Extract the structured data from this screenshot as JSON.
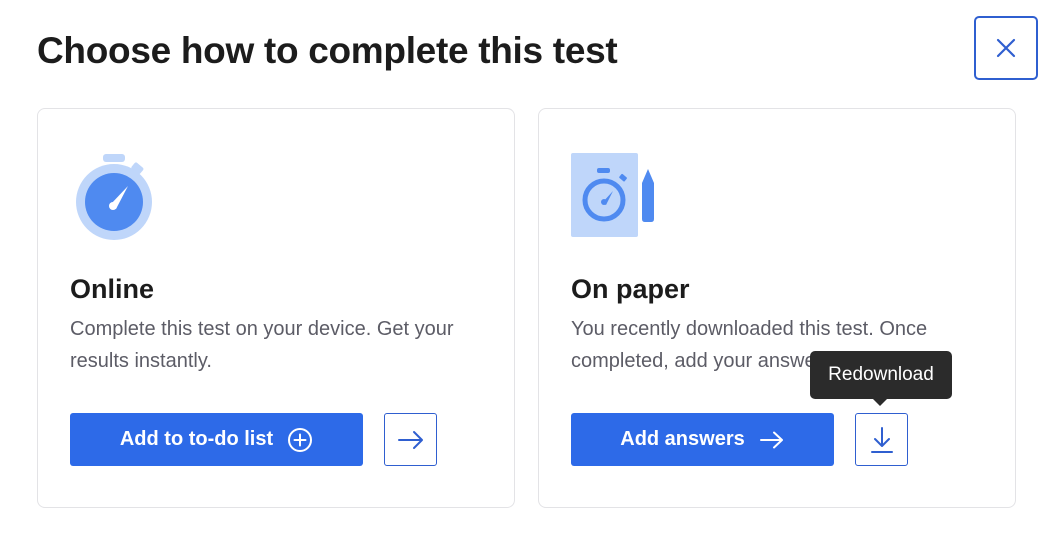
{
  "dialog": {
    "title": "Choose how to complete this test",
    "close_icon": "close-icon"
  },
  "options": [
    {
      "title": "Online",
      "description": "Complete this test on your device. Get your results instantly.",
      "icon": "stopwatch-icon",
      "primary_button": {
        "label": "Add to to-do list",
        "icon": "plus-circle-icon"
      },
      "secondary_button": {
        "icon": "arrow-right-icon"
      }
    },
    {
      "title": "On paper",
      "description": "You recently downloaded this test. Once completed, add your answers",
      "icon": "stopwatch-pencil-icon",
      "primary_button": {
        "label": "Add answers",
        "icon": "arrow-right-icon"
      },
      "secondary_button": {
        "icon": "download-icon",
        "tooltip": "Redownload"
      }
    }
  ],
  "colors": {
    "primary": "#2d6ae8",
    "outline": "#2f5fd0",
    "icon_light": "#bfd6fa",
    "icon_mid": "#4f8af0",
    "tooltip_bg": "#2b2b2b"
  }
}
